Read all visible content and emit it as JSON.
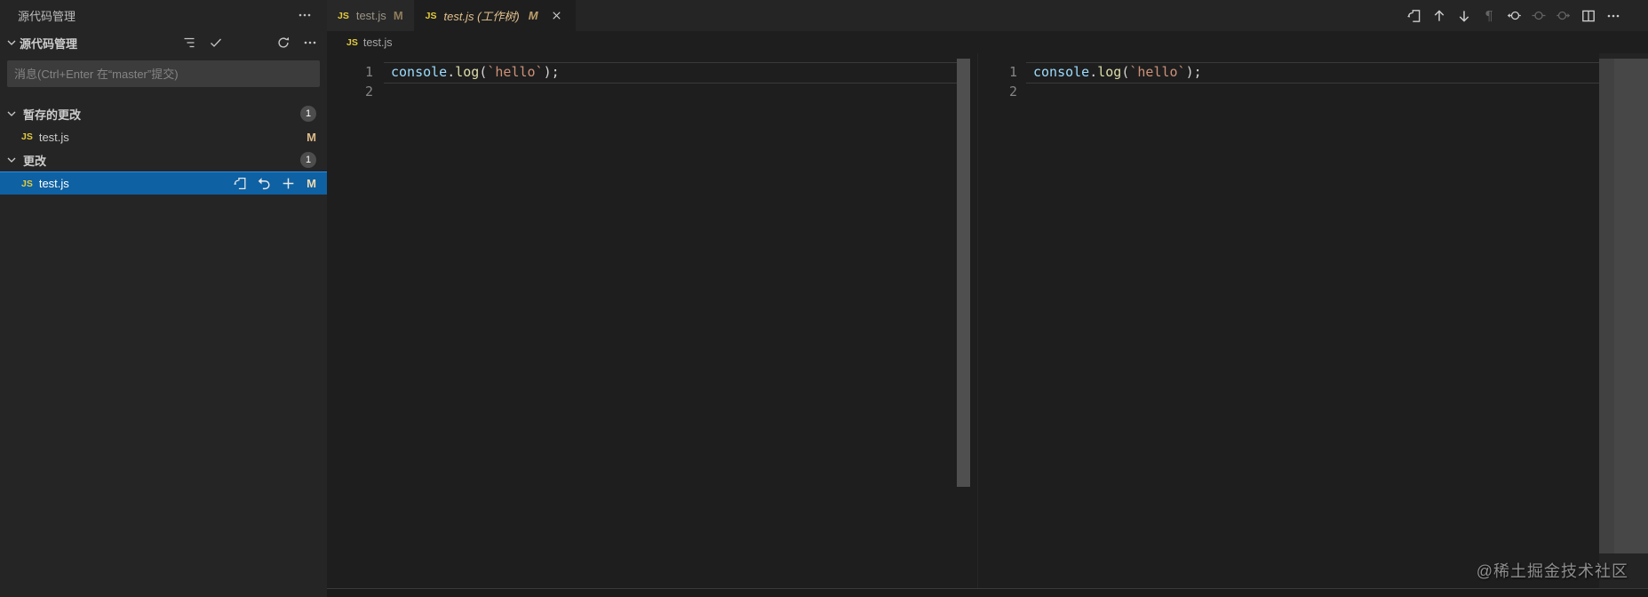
{
  "icons": {
    "js": "JS",
    "pilcrow": "¶"
  },
  "sidebar": {
    "panel_title": "源代码管理",
    "section_title": "源代码管理",
    "commit_placeholder": "消息(Ctrl+Enter 在“master”提交)",
    "groups": [
      {
        "label": "暂存的更改",
        "badge": "1",
        "file": {
          "name": "test.js",
          "status": "M"
        }
      },
      {
        "label": "更改",
        "badge": "1",
        "file": {
          "name": "test.js",
          "status": "M"
        }
      }
    ]
  },
  "tabs": [
    {
      "label": "test.js",
      "status": "M",
      "active": false
    },
    {
      "label": "test.js (工作树)",
      "status": "M",
      "active": true
    }
  ],
  "breadcrumb": {
    "filename": "test.js"
  },
  "editor": {
    "line_numbers": [
      "1",
      "2"
    ],
    "code_line": "console.log(`hello`);",
    "tokens": [
      {
        "text": "console",
        "color": "#9cdcfe"
      },
      {
        "text": ".",
        "color": "#d4d4d4"
      },
      {
        "text": "log",
        "color": "#dcdcaa"
      },
      {
        "text": "(",
        "color": "#d4d4d4"
      },
      {
        "text": "`hello`",
        "color": "#ce9178"
      },
      {
        "text": ");",
        "color": "#d4d4d4"
      }
    ]
  },
  "watermark": {
    "text": "@稀土掘金技术社区"
  },
  "colors": {
    "selection_blue": "#0e61a2",
    "git_modified": "#e2c08d",
    "js_icon_yellow": "#e3cb3f",
    "sidebar_bg": "#252526",
    "editor_bg": "#1e1e1e",
    "badge_bg": "#4d4d4d"
  }
}
